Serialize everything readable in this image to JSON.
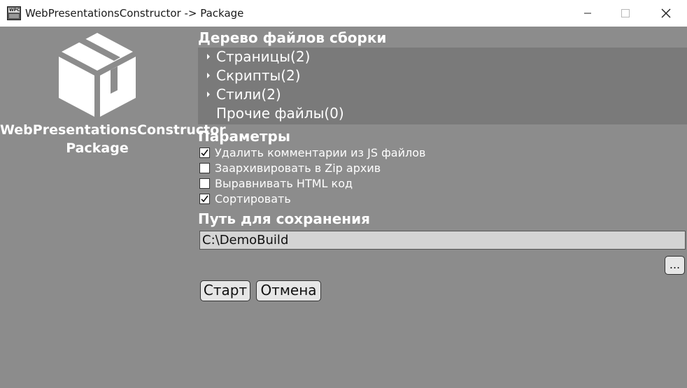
{
  "window": {
    "title": "WebPresentationsConstructor -> Package",
    "icon_text": "WPC",
    "controls": [
      "minimize",
      "maximize",
      "close"
    ]
  },
  "logo": {
    "icon": "package-box-icon",
    "name_line1": "WebPresentationsConstructor",
    "name_line2": "Package"
  },
  "tree": {
    "heading": "Дерево файлов сборки",
    "items": [
      {
        "label": "Страницы(2)",
        "expandable": true
      },
      {
        "label": "Скрипты(2)",
        "expandable": true
      },
      {
        "label": "Стили(2)",
        "expandable": true
      },
      {
        "label": "Прочие файлы(0)",
        "expandable": false
      }
    ]
  },
  "params": {
    "heading": "Параметры",
    "options": [
      {
        "label": "Удалить комментарии из JS файлов",
        "checked": true
      },
      {
        "label": "Заархивировать в Zip архив",
        "checked": false
      },
      {
        "label": "Выравнивать HTML код",
        "checked": false
      },
      {
        "label": "Сортировать",
        "checked": true
      }
    ]
  },
  "save": {
    "heading": "Путь для сохранения",
    "path": "C:\\DemoBuild",
    "browse_label": "..."
  },
  "actions": {
    "start_label": "Старт",
    "cancel_label": "Отмена"
  },
  "colors": {
    "background": "#8c8c8c",
    "tree_background": "#7a7a7a",
    "text": "#ffffff"
  }
}
